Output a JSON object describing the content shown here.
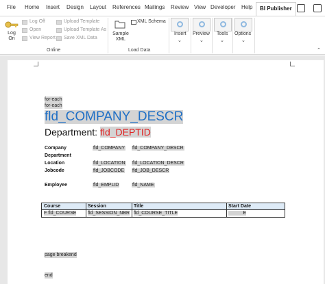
{
  "ribbon_tabs": [
    "File",
    "Home",
    "Insert",
    "Design",
    "Layout",
    "References",
    "Mailings",
    "Review",
    "View",
    "Developer",
    "Help",
    "BI Publisher"
  ],
  "ribbon": {
    "logon_label": "Log On",
    "online": {
      "items": [
        "Log Off",
        "Open",
        "View Report",
        "Upload Template",
        "Upload Template As",
        "Save XML Data"
      ],
      "group_label": "Online"
    },
    "load_data": {
      "sample_xml": "Sample XML",
      "xml_schema": "XML Schema",
      "group_label": "Load Data"
    },
    "insert_label": "Insert",
    "preview_label": "Preview",
    "tools_label": "Tools",
    "options_label": "Options"
  },
  "document": {
    "for_each_1": "for-each",
    "for_each_2": "for-each",
    "company_field": "fld_COMPANY_DESCR",
    "department_label": "Department:",
    "department_field": "fld_DEPTID",
    "rows": [
      {
        "label": "Company",
        "code": "fld_COMPANY",
        "descr": "fld_COMPANY_DESCR"
      },
      {
        "label": "Department",
        "code": "",
        "descr": ""
      },
      {
        "label": "Location",
        "code": "fld_LOCATION",
        "descr": "fld_LOCATION_DESCR"
      },
      {
        "label": "Jobcode",
        "code": "fld_JOBCODE",
        "descr": "fld_JOB_DESCR"
      },
      {
        "label": "Employee",
        "code": "fld_EMPLID",
        "descr": "fld_NAME"
      }
    ],
    "table": {
      "headers": [
        "Course",
        "Session",
        "Title",
        "Start Date"
      ],
      "row": [
        "F fld_COURSE",
        "fld_SESSION_NBR",
        "fld_COURSE_TITLE",
        "E"
      ]
    },
    "page_break": "page breakend",
    "end": "end"
  }
}
